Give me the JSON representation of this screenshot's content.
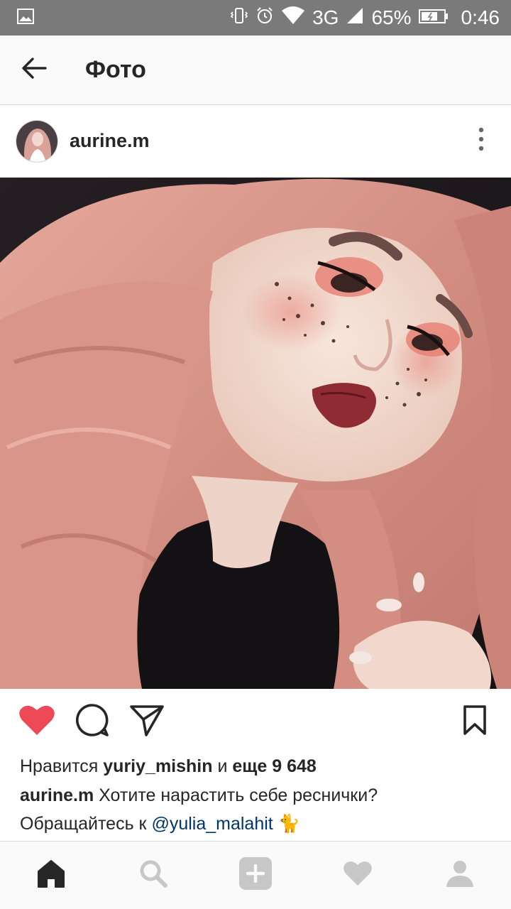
{
  "status_bar": {
    "network": "3G",
    "battery_percent": "65%",
    "time": "0:46"
  },
  "app_bar": {
    "title": "Фото"
  },
  "post": {
    "username": "aurine.m",
    "likes": {
      "prefix": "Нравится",
      "liker": "yuriy_mishin",
      "connector": "и",
      "more_text": "еще 9 648"
    },
    "caption": {
      "author": "aurine.m",
      "text_line1": "Хотите нарастить себе реснички?",
      "text_line2": "Обращайтесь к",
      "mention": "@yulia_malahit",
      "emoji": "🐈"
    }
  },
  "colors": {
    "like_heart": "#ed4956",
    "status_bar": "#7a7a7a",
    "mention": "#003569",
    "hair": "#d9958a"
  },
  "icons": {
    "status_bar": [
      "image-icon",
      "vibrate-icon",
      "alarm-icon",
      "wifi-icon",
      "signal-icon",
      "battery-icon"
    ],
    "actions": [
      "heart-icon",
      "comment-icon",
      "share-icon",
      "bookmark-icon"
    ],
    "bottom_nav": [
      "home-icon",
      "search-icon",
      "add-post-icon",
      "activity-heart-icon",
      "profile-icon"
    ]
  }
}
